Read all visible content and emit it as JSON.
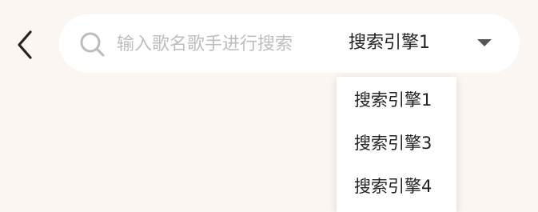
{
  "nav": {
    "back_icon": "chevron-left-icon"
  },
  "search": {
    "icon": "search-icon",
    "placeholder": "输入歌名歌手进行搜索",
    "value": ""
  },
  "engine": {
    "selected": "搜索引擎1",
    "caret_icon": "caret-down-icon",
    "options": [
      "搜索引擎1",
      "搜索引擎3",
      "搜索引擎4"
    ]
  },
  "colors": {
    "background": "#fbf6f1",
    "search_bar": "#ffffff",
    "placeholder": "#bdbdbd",
    "text": "#222222"
  }
}
